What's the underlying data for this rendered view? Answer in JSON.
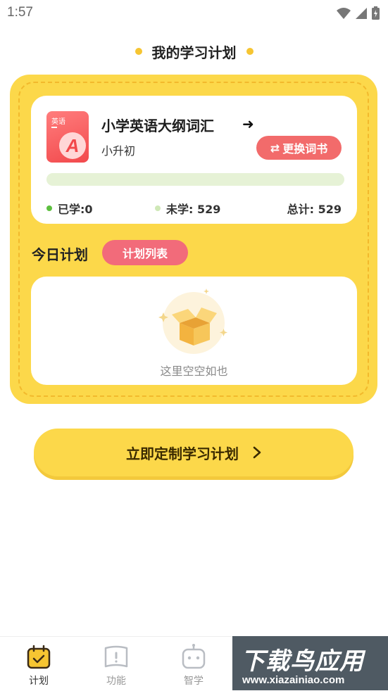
{
  "status_bar": {
    "time": "1:57"
  },
  "page": {
    "title": "我的学习计划"
  },
  "book": {
    "cover_label": "英语",
    "cover_letter": "A",
    "title": "小学英语大纲词汇",
    "subtitle": "小升初",
    "switch_label": "更换词书",
    "progress": 0,
    "stats": {
      "learned": "已学:0",
      "unlearned": "未学: 529",
      "total": "总计: 529"
    }
  },
  "today": {
    "label": "今日计划",
    "list_button": "计划列表",
    "empty_text": "这里空空如也"
  },
  "cta": {
    "label": "立即定制学习计划"
  },
  "tabs": [
    {
      "label": "计划",
      "icon": "calendar-icon",
      "active": true
    },
    {
      "label": "功能",
      "icon": "book-icon",
      "active": false
    },
    {
      "label": "智学",
      "icon": "robot-icon",
      "active": false
    }
  ],
  "watermark": {
    "main": "下载鸟应用",
    "url": "www.xiazainiao.com"
  },
  "colors": {
    "accent_yellow": "#fcd84a",
    "accent_red": "#f26b6b",
    "progress_green": "#8ed06b"
  }
}
